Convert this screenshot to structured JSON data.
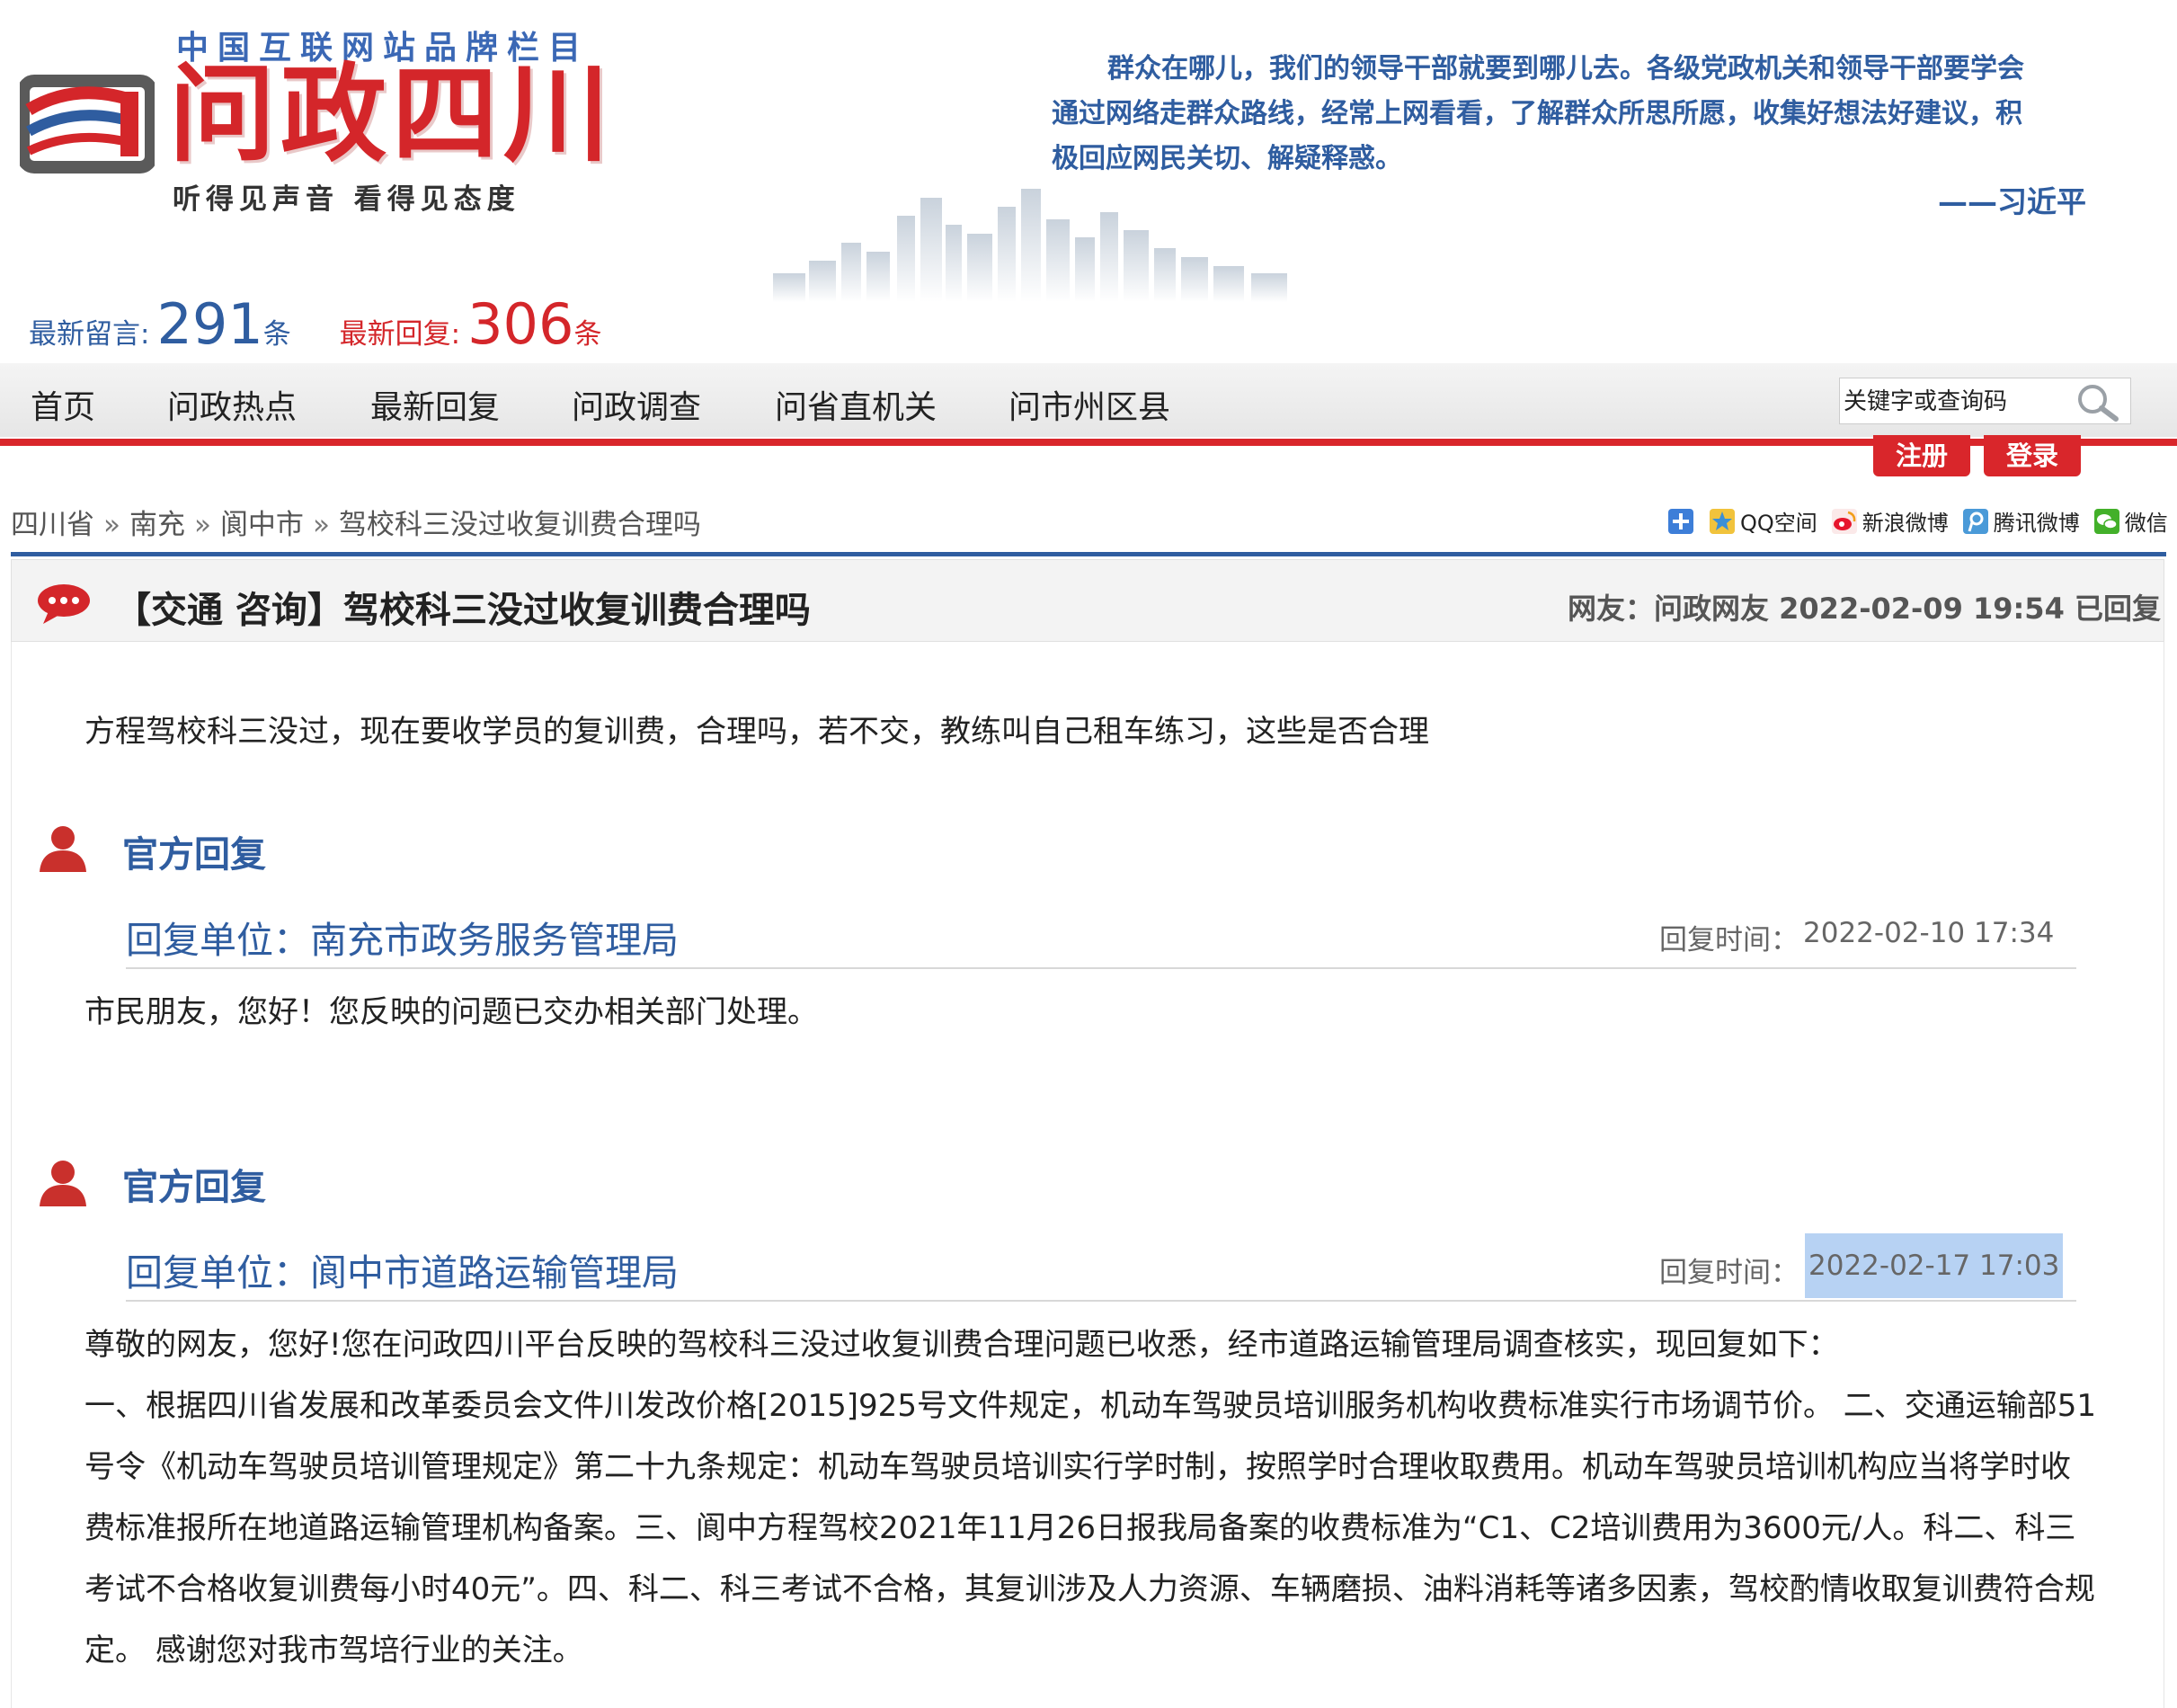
{
  "header": {
    "slogan_top": "中国互联网站品牌栏目",
    "logo_text": "问政四川",
    "slogan_bottom": "听得见声音    看得见态度",
    "quote_line1": "群众在哪儿，我们的领导干部就要到哪儿去。各级党政机关和领导干部要学会",
    "quote_line2": "通过网络走群众路线，经常上网看看，了解群众所思所愿，收集好想法好建议，积",
    "quote_line3": "极回应网民关切、解疑释惑。",
    "quote_author": "——习近平"
  },
  "stats": {
    "messages_label": "最新留言:",
    "messages_count": "291",
    "messages_unit": "条",
    "replies_label": "最新回复:",
    "replies_count": "306",
    "replies_unit": "条"
  },
  "nav": {
    "items": [
      "首页",
      "问政热点",
      "最新回复",
      "问政调查",
      "问省直机关",
      "问市州区县"
    ],
    "search_placeholder": "关键字或查询码",
    "register": "注册",
    "login": "登录"
  },
  "breadcrumb": {
    "items": [
      "四川省",
      "南充",
      "阆中市",
      "驾校科三没过收复训费合理吗"
    ],
    "separator": "»"
  },
  "share": {
    "qzone": "QQ空间",
    "weibo": "新浪微博",
    "tencent": "腾讯微博",
    "wechat": "微信"
  },
  "post": {
    "title": "【交通 咨询】驾校科三没过收复训费合理吗",
    "meta": "网友：问政网友   2022-02-09 19:54  已回复",
    "content": "方程驾校科三没过，现在要收学员的复训费，合理吗，若不交，教练叫自己租车练习，这些是否合理"
  },
  "replies": [
    {
      "heading": "官方回复",
      "unit": "回复单位：南充市政务服务管理局",
      "time_label": "回复时间：",
      "time": "2022-02-10 17:34",
      "body": "市民朋友，您好！您反映的问题已交办相关部门处理。"
    },
    {
      "heading": "官方回复",
      "unit": "回复单位：阆中市道路运输管理局",
      "time_label": "回复时间：",
      "time": "2022-02-17 17:03",
      "body": "尊敬的网友，您好!您在问政四川平台反映的驾校科三没过收复训费合理问题已收悉，经市道路运输管理局调查核实，现回复如下：\n一、根据四川省发展和改革委员会文件川发改价格[2015]925号文件规定，机动车驾驶员培训服务机构收费标准实行市场调节价。 二、交通运输部51号令《机动车驾驶员培训管理规定》第二十九条规定：机动车驾驶员培训实行学时制，按照学时合理收取费用。机动车驾驶员培训机构应当将学时收费标准报所在地道路运输管理机构备案。三、阆中方程驾校2021年11月26日报我局备案的收费标准为“C1、C2培训费用为3600元/人。科二、科三考试不合格收复训费每小时40元”。四、科二、科三考试不合格，其复训涉及人力资源、车辆磨损、油料消耗等诸多因素，驾校酌情收取复训费符合规定。 感谢您对我市驾培行业的关注。"
    }
  ],
  "colors": {
    "brand_red": "#d4262a",
    "brand_blue": "#2f5da0",
    "highlight": "#b7d2f3"
  }
}
